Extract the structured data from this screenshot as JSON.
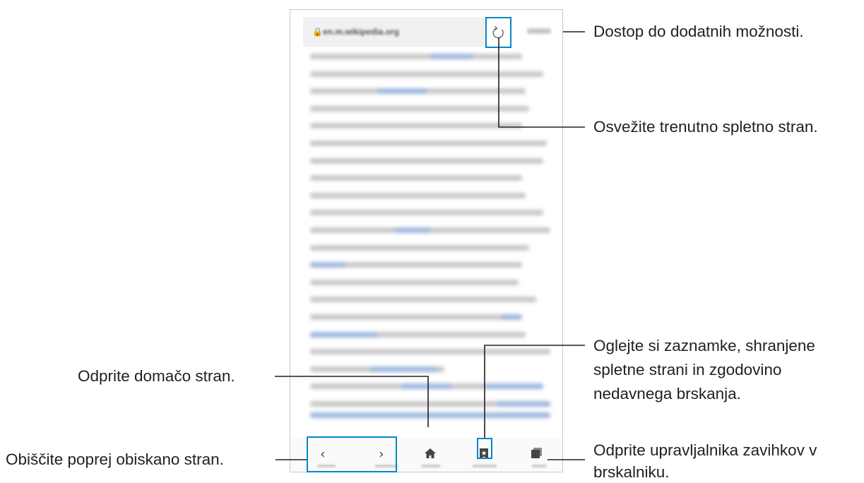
{
  "browser": {
    "url": "en.m.wikipedia.org",
    "icons": {
      "lock": "lock-icon",
      "reload": "refresh-icon",
      "back": "chevron-left-icon",
      "forward": "chevron-right-icon",
      "home": "home-icon",
      "bookmarks": "bookmark-star-icon",
      "tabs": "tabs-icon"
    },
    "accent_color": "#0088c8"
  },
  "callouts": {
    "more_options": "Dostop do dodatnih možnosti.",
    "refresh": "Osvežite trenutno spletno stran.",
    "bookmarks_line1": "Oglejte si zaznamke, shranjene",
    "bookmarks_line2": "spletne strani in zgodovino",
    "bookmarks_line3": "nedavnega brskanja.",
    "home": "Odprite domačo stran.",
    "back_forward": "Obiščite poprej obiskano stran.",
    "tabs_line1": "Odprite upravljalnika zavihkov v",
    "tabs_line2": "brskalniku."
  }
}
